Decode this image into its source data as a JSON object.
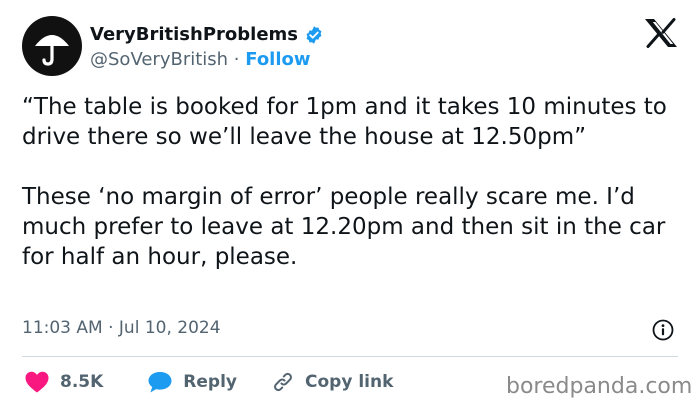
{
  "author": {
    "display_name": "VeryBritishProblems",
    "handle": "@SoVeryBritish",
    "separator": " · ",
    "follow_label": "Follow",
    "verified": true,
    "avatar_icon": "umbrella-icon"
  },
  "platform_logo": "x-logo",
  "tweet": {
    "paragraphs": [
      "“The table is booked for 1pm and it takes 10 minutes to drive there so we’ll leave the house at 12.50pm”",
      "These ‘no margin of error’ people really scare me. I’d much prefer to leave at 12.20pm and then sit in the car for half an hour, please."
    ],
    "timestamp": "11:03 AM · Jul 10, 2024"
  },
  "actions": {
    "like_count": "8.5K",
    "reply_label": "Reply",
    "copy_link_label": "Copy link"
  },
  "watermark": "boredpanda.com",
  "colors": {
    "accent": "#1d9bf0",
    "like": "#f91880",
    "text": "#0f1419",
    "muted": "#536471"
  }
}
